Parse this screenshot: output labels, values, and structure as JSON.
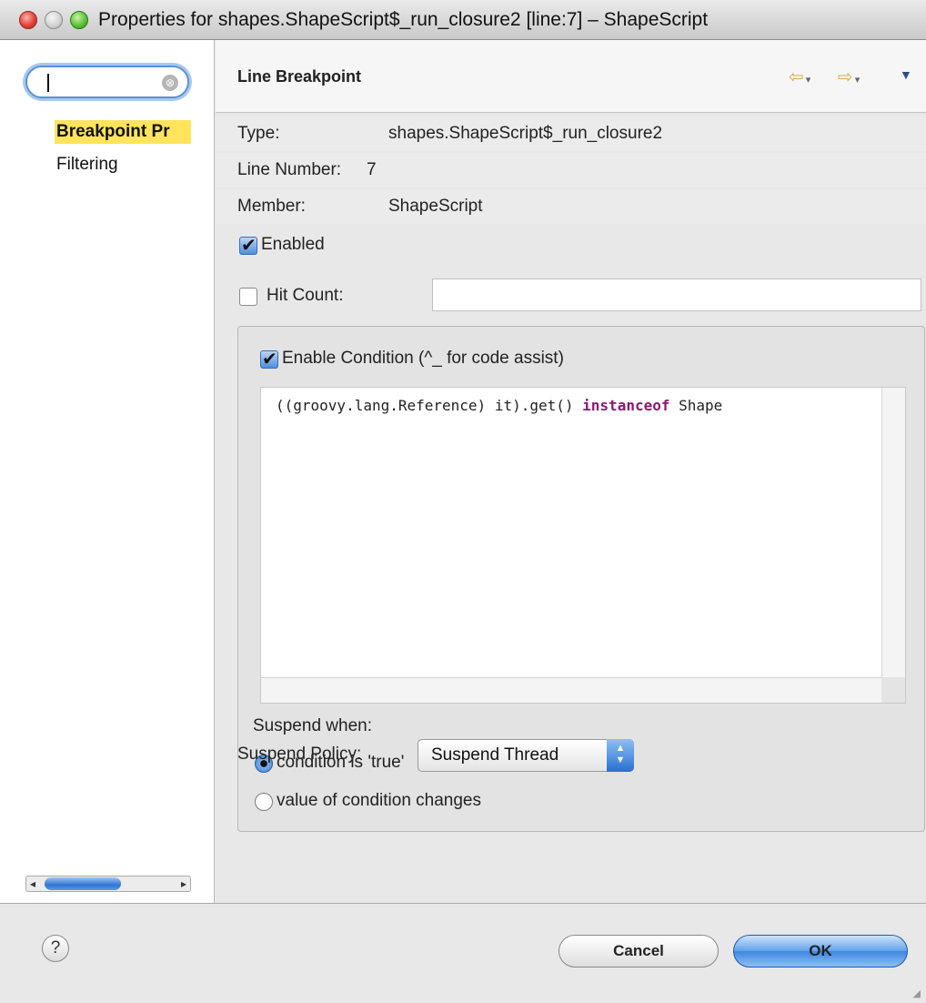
{
  "window": {
    "title": "Properties for shapes.ShapeScript$_run_closure2 [line:7] – ShapeScript",
    "traffic_lights": [
      "close",
      "minimize",
      "zoom"
    ]
  },
  "sidebar": {
    "search": {
      "value": "",
      "clear_icon": "⊗"
    },
    "items": [
      {
        "label": "Breakpoint Pr",
        "selected": true
      },
      {
        "label": "Filtering",
        "selected": false
      }
    ],
    "scrollbar": {
      "left_arrow": "◂",
      "right_arrow": "▸"
    }
  },
  "main": {
    "title": "Line Breakpoint",
    "nav": {
      "back_icon": "⇦",
      "forward_icon": "⇨",
      "dropdown_marker": "▾",
      "menu_icon": "▼"
    },
    "fields": [
      {
        "label": "Type:",
        "value": "shapes.ShapeScript$_run_closure2"
      },
      {
        "label": "Line Number:",
        "value": "7"
      },
      {
        "label": "Member:",
        "value": "ShapeScript"
      }
    ],
    "enabled": {
      "label": "Enabled",
      "checked": true
    },
    "hit_count": {
      "label": "Hit Count:",
      "checked": false,
      "value": ""
    },
    "condition": {
      "label": "Enable Condition (^_ for code assist)",
      "checked": true,
      "code_prefix": "((groovy.lang.Reference) it).get() ",
      "code_keyword": "instanceof",
      "code_suffix": " Shape"
    },
    "suspend_when": {
      "label": "Suspend when:",
      "options": [
        {
          "label": "condition is 'true'",
          "selected": true
        },
        {
          "label": "value of condition changes",
          "selected": false
        }
      ]
    },
    "suspend_policy": {
      "label": "Suspend Policy:",
      "value": "Suspend Thread"
    }
  },
  "buttons": {
    "help_icon": "?",
    "cancel": "Cancel",
    "ok": "OK"
  },
  "colors": {
    "selection_highlight": "#ffe45c",
    "keyword": "#8a1a6e",
    "accent_blue": "#3d86de"
  }
}
